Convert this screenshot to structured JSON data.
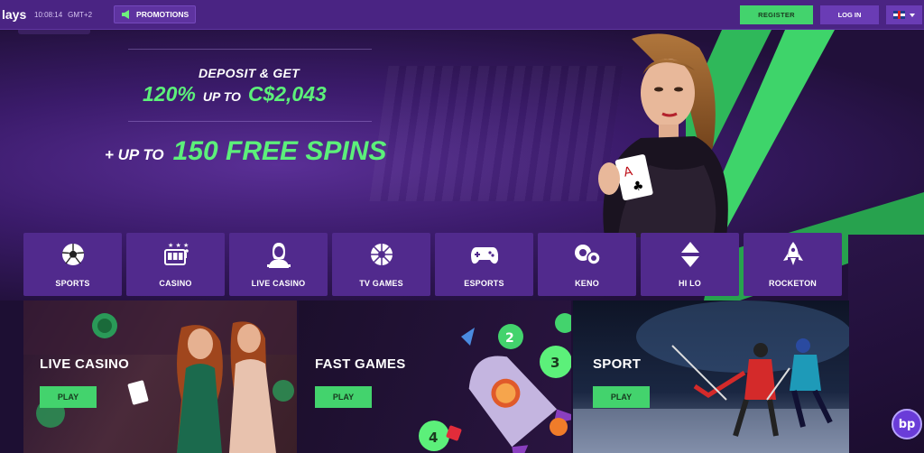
{
  "topbar": {
    "logo": "lays",
    "time": "10:08:14",
    "timezone": "GMT+2",
    "promotions_label": "PROMOTIONS",
    "register_label": "REGISTER",
    "login_label": "LOG IN",
    "language": "flag-uk-icon"
  },
  "hero": {
    "deposit_text": "DEPOSIT & GET",
    "bonus_percent": "120%",
    "bonus_upto": "UP TO",
    "bonus_amount": "C$2,043",
    "spins_prefix": "+ UP TO",
    "spins_text": "150 FREE SPINS"
  },
  "categories": [
    {
      "label": "SPORTS",
      "icon": "soccer-ball-icon"
    },
    {
      "label": "CASINO",
      "icon": "slot-machine-icon"
    },
    {
      "label": "LIVE CASINO",
      "icon": "dealer-icon"
    },
    {
      "label": "TV GAMES",
      "icon": "roulette-wheel-icon"
    },
    {
      "label": "ESPORTS",
      "icon": "gamepad-icon"
    },
    {
      "label": "KENO",
      "icon": "keno-balls-icon"
    },
    {
      "label": "HI LO",
      "icon": "hi-lo-arrows-icon"
    },
    {
      "label": "ROCKETON",
      "icon": "rocket-icon"
    }
  ],
  "tiles": [
    {
      "title": "LIVE CASINO",
      "play_label": "PLAY"
    },
    {
      "title": "FAST GAMES",
      "play_label": "PLAY"
    },
    {
      "title": "SPORT",
      "play_label": "PLAY"
    }
  ],
  "chat_badge": "bp",
  "colors": {
    "accent_green": "#43d36d",
    "bonus_green": "#5cf07a",
    "purple_bar": "#4a2483",
    "tile_purple": "#512a8d"
  }
}
